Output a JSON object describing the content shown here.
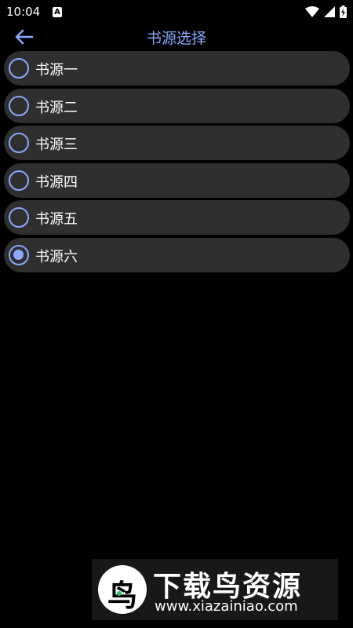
{
  "status_bar": {
    "time": "10:04",
    "notification_icon": "A",
    "icons": [
      "wifi-icon",
      "signal-icon",
      "battery-icon"
    ]
  },
  "app_bar": {
    "title": "书源选择",
    "back_icon": "arrow-left-icon",
    "accent_color": "#8aa9ff"
  },
  "sources": [
    {
      "label": "书源一",
      "selected": false
    },
    {
      "label": "书源二",
      "selected": false
    },
    {
      "label": "书源三",
      "selected": false
    },
    {
      "label": "书源四",
      "selected": false
    },
    {
      "label": "书源五",
      "selected": false
    },
    {
      "label": "书源六",
      "selected": true
    }
  ],
  "watermark": {
    "title": "下载鸟资源",
    "url": "www.xiazainiao.com"
  }
}
